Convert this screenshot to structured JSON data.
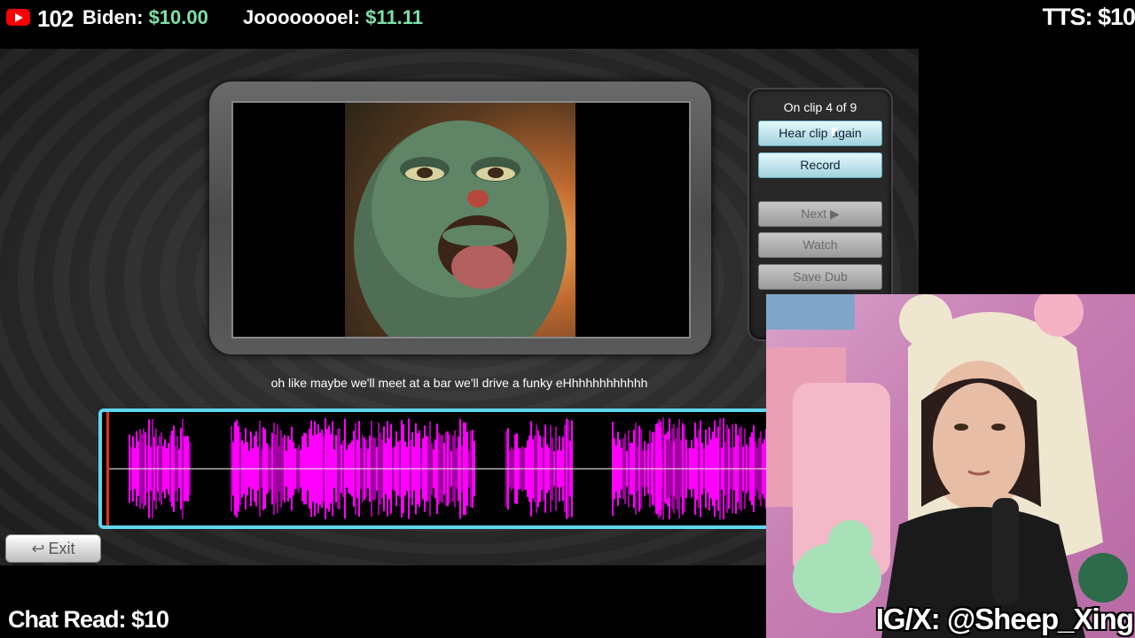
{
  "overlay": {
    "viewer_count": "102",
    "donors": [
      {
        "name": "Biden: ",
        "amount": "$10.00"
      },
      {
        "name": "Joooooooel: ",
        "amount": "$11.11"
      }
    ],
    "tts": "TTS: $10",
    "chat_read": "Chat Read: $10",
    "social_handle": "IG/X: @Sheep_Xing"
  },
  "controls": {
    "clip_status": "On clip 4 of 9",
    "hear_again": "Hear clip again",
    "record": "Record",
    "next": "Next ▶",
    "watch": "Watch",
    "save_dub": "Save Dub",
    "exit": "Exit"
  },
  "subtitle": "oh like maybe we'll meet at a bar we'll drive a funky eHhhhhhhhhhhh",
  "colors": {
    "accent": "#5fd6ef",
    "waveform": "#ff00ff",
    "donation_amount": "#7ee0a8"
  },
  "icons": {
    "youtube": "youtube-icon",
    "exit": "return-arrow-icon",
    "cursor": "mouse-cursor-icon"
  }
}
